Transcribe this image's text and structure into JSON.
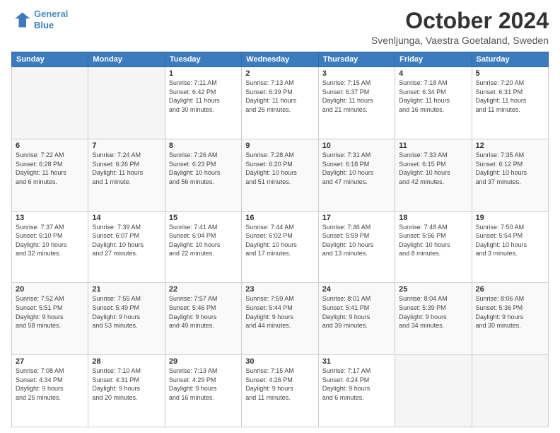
{
  "header": {
    "logo_line1": "General",
    "logo_line2": "Blue",
    "month": "October 2024",
    "location": "Svenljunga, Vaestra Goetaland, Sweden"
  },
  "weekdays": [
    "Sunday",
    "Monday",
    "Tuesday",
    "Wednesday",
    "Thursday",
    "Friday",
    "Saturday"
  ],
  "weeks": [
    [
      {
        "day": "",
        "info": ""
      },
      {
        "day": "",
        "info": ""
      },
      {
        "day": "1",
        "info": "Sunrise: 7:11 AM\nSunset: 6:42 PM\nDaylight: 11 hours\nand 30 minutes."
      },
      {
        "day": "2",
        "info": "Sunrise: 7:13 AM\nSunset: 6:39 PM\nDaylight: 11 hours\nand 26 minutes."
      },
      {
        "day": "3",
        "info": "Sunrise: 7:15 AM\nSunset: 6:37 PM\nDaylight: 11 hours\nand 21 minutes."
      },
      {
        "day": "4",
        "info": "Sunrise: 7:18 AM\nSunset: 6:34 PM\nDaylight: 11 hours\nand 16 minutes."
      },
      {
        "day": "5",
        "info": "Sunrise: 7:20 AM\nSunset: 6:31 PM\nDaylight: 11 hours\nand 11 minutes."
      }
    ],
    [
      {
        "day": "6",
        "info": "Sunrise: 7:22 AM\nSunset: 6:28 PM\nDaylight: 11 hours\nand 6 minutes."
      },
      {
        "day": "7",
        "info": "Sunrise: 7:24 AM\nSunset: 6:26 PM\nDaylight: 11 hours\nand 1 minute."
      },
      {
        "day": "8",
        "info": "Sunrise: 7:26 AM\nSunset: 6:23 PM\nDaylight: 10 hours\nand 56 minutes."
      },
      {
        "day": "9",
        "info": "Sunrise: 7:28 AM\nSunset: 6:20 PM\nDaylight: 10 hours\nand 51 minutes."
      },
      {
        "day": "10",
        "info": "Sunrise: 7:31 AM\nSunset: 6:18 PM\nDaylight: 10 hours\nand 47 minutes."
      },
      {
        "day": "11",
        "info": "Sunrise: 7:33 AM\nSunset: 6:15 PM\nDaylight: 10 hours\nand 42 minutes."
      },
      {
        "day": "12",
        "info": "Sunrise: 7:35 AM\nSunset: 6:12 PM\nDaylight: 10 hours\nand 37 minutes."
      }
    ],
    [
      {
        "day": "13",
        "info": "Sunrise: 7:37 AM\nSunset: 6:10 PM\nDaylight: 10 hours\nand 32 minutes."
      },
      {
        "day": "14",
        "info": "Sunrise: 7:39 AM\nSunset: 6:07 PM\nDaylight: 10 hours\nand 27 minutes."
      },
      {
        "day": "15",
        "info": "Sunrise: 7:41 AM\nSunset: 6:04 PM\nDaylight: 10 hours\nand 22 minutes."
      },
      {
        "day": "16",
        "info": "Sunrise: 7:44 AM\nSunset: 6:02 PM\nDaylight: 10 hours\nand 17 minutes."
      },
      {
        "day": "17",
        "info": "Sunrise: 7:46 AM\nSunset: 5:59 PM\nDaylight: 10 hours\nand 13 minutes."
      },
      {
        "day": "18",
        "info": "Sunrise: 7:48 AM\nSunset: 5:56 PM\nDaylight: 10 hours\nand 8 minutes."
      },
      {
        "day": "19",
        "info": "Sunrise: 7:50 AM\nSunset: 5:54 PM\nDaylight: 10 hours\nand 3 minutes."
      }
    ],
    [
      {
        "day": "20",
        "info": "Sunrise: 7:52 AM\nSunset: 5:51 PM\nDaylight: 9 hours\nand 58 minutes."
      },
      {
        "day": "21",
        "info": "Sunrise: 7:55 AM\nSunset: 5:49 PM\nDaylight: 9 hours\nand 53 minutes."
      },
      {
        "day": "22",
        "info": "Sunrise: 7:57 AM\nSunset: 5:46 PM\nDaylight: 9 hours\nand 49 minutes."
      },
      {
        "day": "23",
        "info": "Sunrise: 7:59 AM\nSunset: 5:44 PM\nDaylight: 9 hours\nand 44 minutes."
      },
      {
        "day": "24",
        "info": "Sunrise: 8:01 AM\nSunset: 5:41 PM\nDaylight: 9 hours\nand 39 minutes."
      },
      {
        "day": "25",
        "info": "Sunrise: 8:04 AM\nSunset: 5:39 PM\nDaylight: 9 hours\nand 34 minutes."
      },
      {
        "day": "26",
        "info": "Sunrise: 8:06 AM\nSunset: 5:36 PM\nDaylight: 9 hours\nand 30 minutes."
      }
    ],
    [
      {
        "day": "27",
        "info": "Sunrise: 7:08 AM\nSunset: 4:34 PM\nDaylight: 9 hours\nand 25 minutes."
      },
      {
        "day": "28",
        "info": "Sunrise: 7:10 AM\nSunset: 4:31 PM\nDaylight: 9 hours\nand 20 minutes."
      },
      {
        "day": "29",
        "info": "Sunrise: 7:13 AM\nSunset: 4:29 PM\nDaylight: 9 hours\nand 16 minutes."
      },
      {
        "day": "30",
        "info": "Sunrise: 7:15 AM\nSunset: 4:26 PM\nDaylight: 9 hours\nand 11 minutes."
      },
      {
        "day": "31",
        "info": "Sunrise: 7:17 AM\nSunset: 4:24 PM\nDaylight: 9 hours\nand 6 minutes."
      },
      {
        "day": "",
        "info": ""
      },
      {
        "day": "",
        "info": ""
      }
    ]
  ]
}
